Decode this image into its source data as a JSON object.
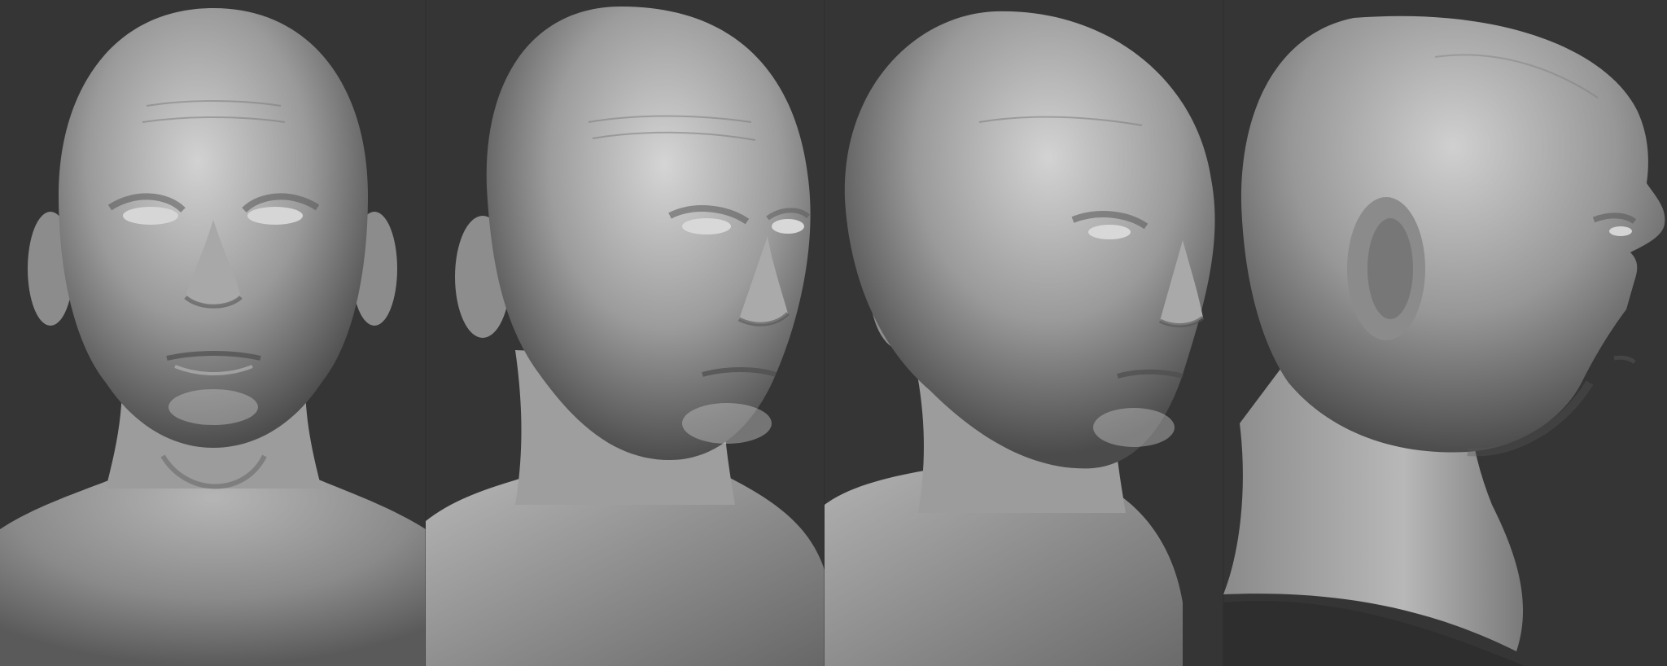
{
  "scene": {
    "description_free": true,
    "background_color": "#353535",
    "render_material": "matte-gray-clay",
    "views": [
      {
        "id": "front",
        "angle_label": "front"
      },
      {
        "id": "three-quarter-left",
        "angle_label": "three-quarter"
      },
      {
        "id": "three-quarter-deep",
        "angle_label": "three-quarter"
      },
      {
        "id": "profile",
        "angle_label": "profile"
      }
    ]
  },
  "colors": {
    "clay_light": "#c9c9c9",
    "clay_mid": "#8f8f8f",
    "clay_dark": "#4a4a4a",
    "background": "#353535"
  }
}
